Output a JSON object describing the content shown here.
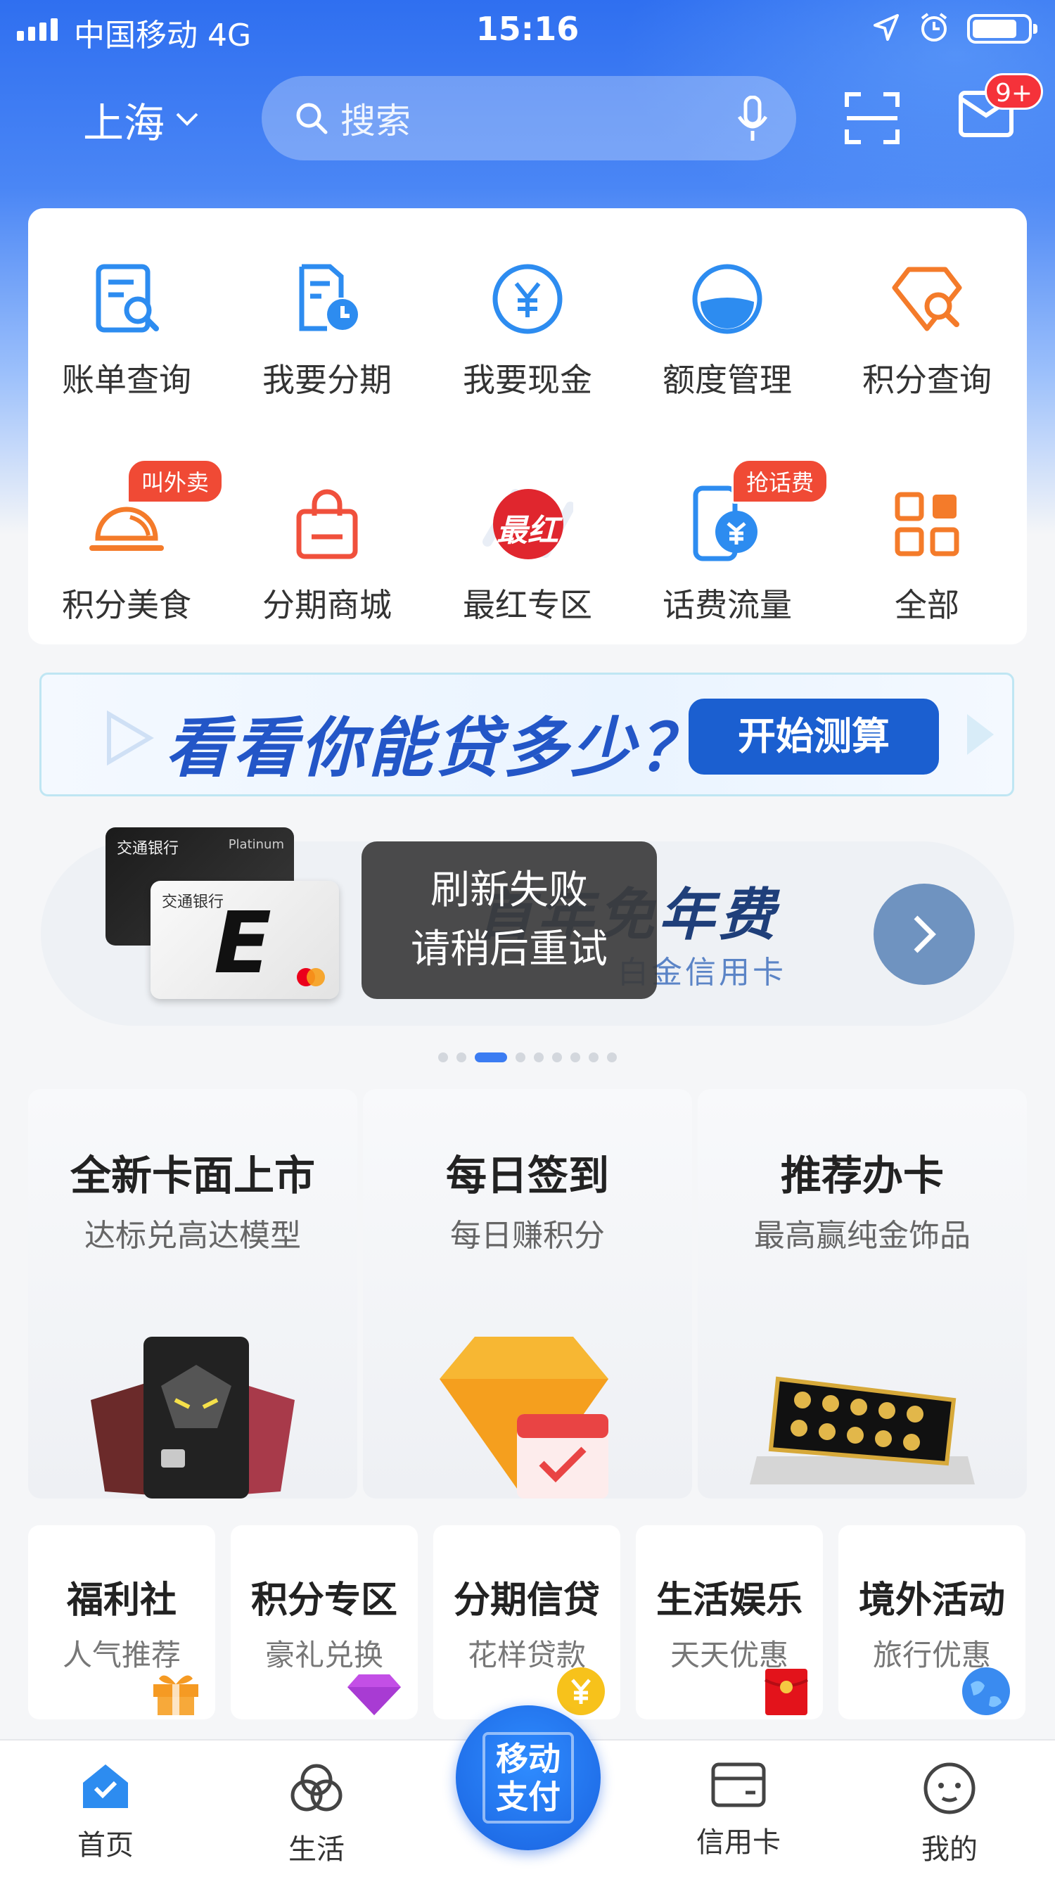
{
  "status_bar": {
    "carrier": "中国移动  4G",
    "time": "15:16"
  },
  "top_bar": {
    "city": "上海",
    "search_placeholder": "搜索",
    "mail_badge": "9+"
  },
  "grid": {
    "row1": [
      {
        "label": "账单查询",
        "icon": "bill-search-icon"
      },
      {
        "label": "我要分期",
        "icon": "installment-icon"
      },
      {
        "label": "我要现金",
        "icon": "cash-yuan-icon"
      },
      {
        "label": "额度管理",
        "icon": "credit-limit-icon"
      },
      {
        "label": "积分查询",
        "icon": "points-search-icon"
      }
    ],
    "row2": [
      {
        "label": "积分美食",
        "icon": "food-cloche-icon",
        "badge": "叫外卖"
      },
      {
        "label": "分期商城",
        "icon": "shopping-bag-icon"
      },
      {
        "label": "最红专区",
        "icon": "zuihong-icon",
        "icon_text": "最红"
      },
      {
        "label": "话费流量",
        "icon": "phone-bill-icon",
        "badge": "抢话费"
      },
      {
        "label": "全部",
        "icon": "all-grid-icon"
      }
    ]
  },
  "loan_banner": {
    "title": "看看你能贷多少？",
    "button": "开始测算"
  },
  "carousel": {
    "title": "首年免年费",
    "subtitle": "白金信用卡",
    "card_text": {
      "bank": "交通银行",
      "platinum": "Platinum",
      "lite": "E"
    },
    "dot_count": 9,
    "active_dot": 2
  },
  "toast": {
    "line1": "刷新失败",
    "line2": "请稍后重试"
  },
  "promos": [
    {
      "title": "全新卡面上市",
      "subtitle": "达标兑高达模型",
      "pic": "gundam-cards-image"
    },
    {
      "title": "每日签到",
      "subtitle": "每日赚积分",
      "pic": "diamond-calendar-image"
    },
    {
      "title": "推荐办卡",
      "subtitle": "最高赢纯金饰品",
      "pic": "gold-coins-image"
    }
  ],
  "categories": [
    {
      "title": "福利社",
      "subtitle": "人气推荐",
      "icon": "gift-icon"
    },
    {
      "title": "积分专区",
      "subtitle": "豪礼兑换",
      "icon": "gem-icon"
    },
    {
      "title": "分期信贷",
      "subtitle": "花样贷款",
      "icon": "yuan-coin-icon"
    },
    {
      "title": "生活娱乐",
      "subtitle": "天天优惠",
      "icon": "red-envelope-icon"
    },
    {
      "title": "境外活动",
      "subtitle": "旅行优惠",
      "icon": "globe-icon"
    }
  ],
  "tabbar": {
    "home": "首页",
    "life": "生活",
    "pay_line1": "移动",
    "pay_line2": "支付",
    "credit_card": "信用卡",
    "mine": "我的"
  },
  "colors": {
    "primary_blue": "#2f6ff0",
    "icon_blue": "#2d8cf0",
    "icon_orange": "#f47b2a",
    "badge_red": "#f04a35"
  }
}
